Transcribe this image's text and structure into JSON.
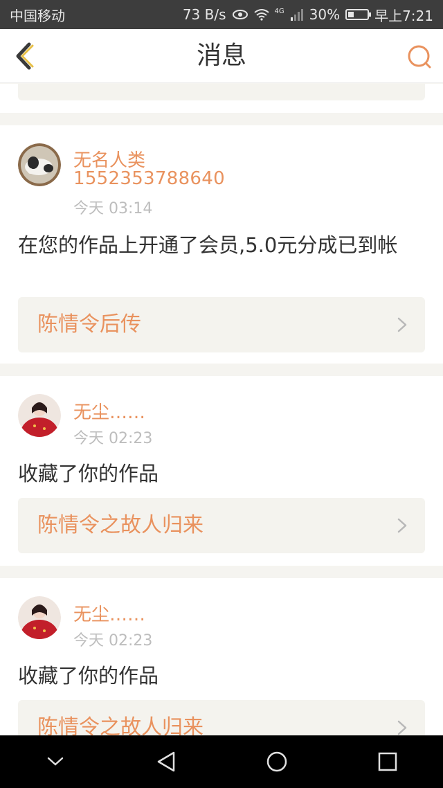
{
  "status_bar": {
    "carrier": "中国移动",
    "net_speed": "73 B/s",
    "network_type": "4G",
    "battery_percent": "30%",
    "battery_level": 0.3,
    "time": "早上7:21"
  },
  "header": {
    "title": "消息",
    "back_icon": "chevron-left-icon",
    "search_icon": "search-icon",
    "accent_color": "#e9925e"
  },
  "messages": [
    {
      "name": "无名人类",
      "phone": "1552353788640",
      "time": "今天 03:14",
      "text": "在您的作品上开通了会员,5.0元分成已到帐",
      "work_title": "陈情令后传"
    },
    {
      "name": "无尘……",
      "time": "今天 02:23",
      "text": "收藏了你的作品",
      "work_title": "陈情令之故人归来"
    },
    {
      "name": "无尘……",
      "time": "今天 02:23",
      "text": "收藏了你的作品",
      "work_title": "陈情令之故人归来"
    }
  ],
  "nav_bar": {
    "icons": [
      "chevron-down-icon",
      "back-triangle-icon",
      "home-circle-icon",
      "recents-square-icon"
    ]
  }
}
